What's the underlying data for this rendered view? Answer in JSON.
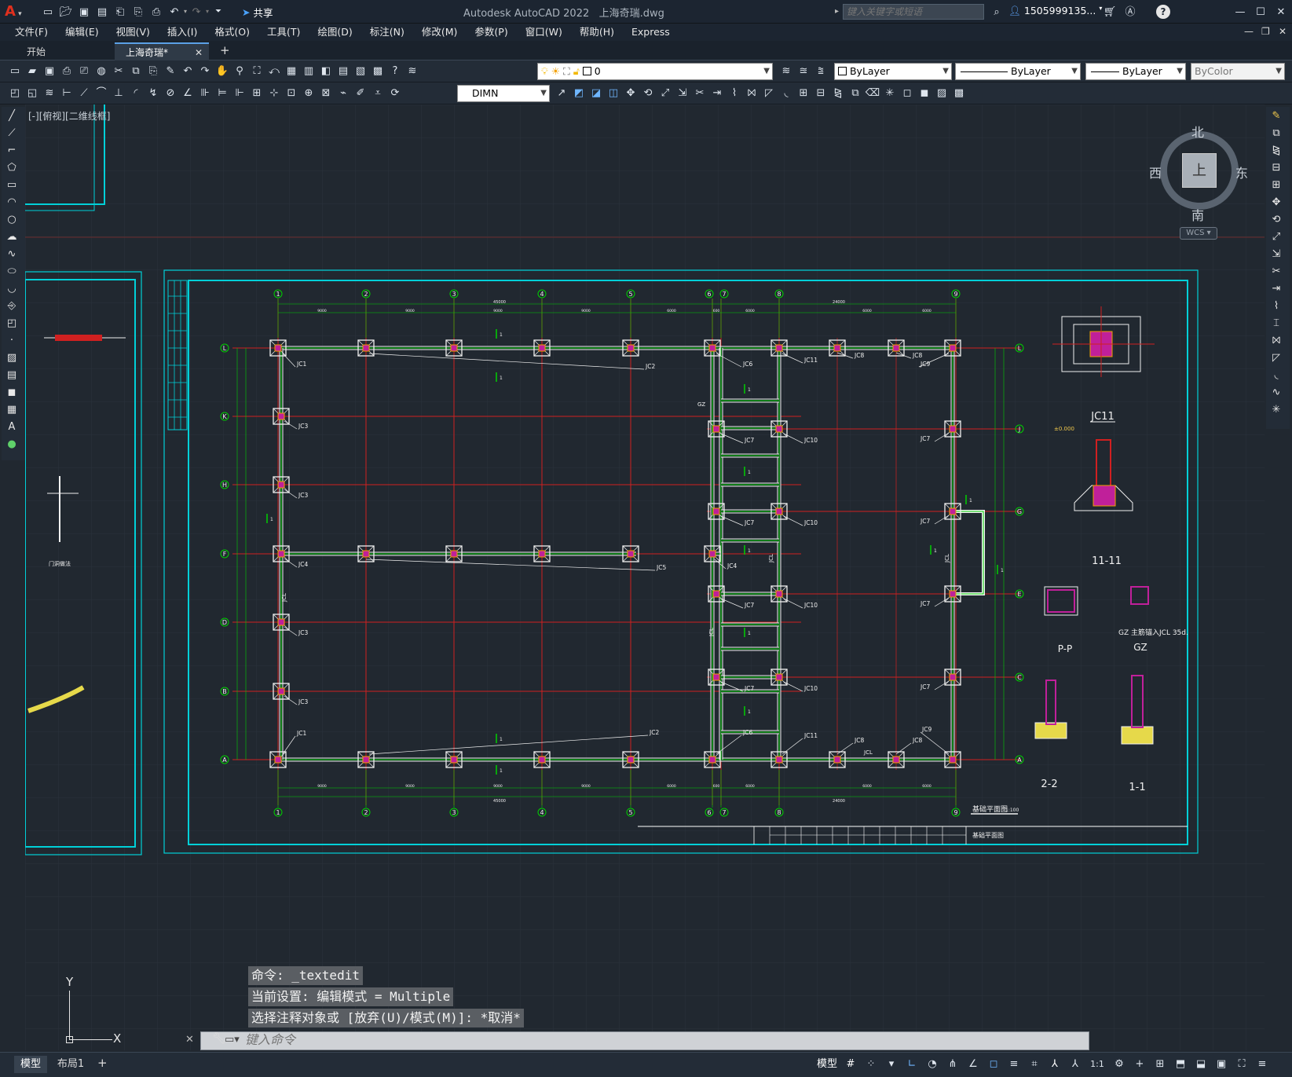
{
  "app": {
    "title": "Autodesk AutoCAD 2022",
    "file": "上海奇瑞.dwg",
    "share_label": "共享",
    "search_placeholder": "键入关键字或短语",
    "user": "1505999135...",
    "logo": "A"
  },
  "menu": [
    "文件(F)",
    "编辑(E)",
    "视图(V)",
    "插入(I)",
    "格式(O)",
    "工具(T)",
    "绘图(D)",
    "标注(N)",
    "修改(M)",
    "参数(P)",
    "窗口(W)",
    "帮助(H)",
    "Express"
  ],
  "tabs": {
    "start": "开始",
    "active": "上海奇瑞*",
    "add": "+"
  },
  "layer": {
    "current": "0",
    "color": "ByLayer",
    "linetype": "ByLayer",
    "lineweight": "ByLayer",
    "plotstyle": "ByColor"
  },
  "dimstyle": "DIMN",
  "viewport_label": "[-][俯视][二维线框]",
  "viewcube": {
    "north": "北",
    "south": "南",
    "east": "东",
    "west": "西",
    "top": "上",
    "wcs": "WCS"
  },
  "drawing": {
    "grid_x": [
      "1",
      "2",
      "3",
      "4",
      "5",
      "6",
      "7",
      "8",
      "9"
    ],
    "grid_y": [
      "L",
      "K",
      "H",
      "F",
      "D",
      "B",
      "A"
    ],
    "grid_y_right": [
      "L",
      "J",
      "G",
      "E",
      "C",
      "A"
    ],
    "footings_top": [
      "JC1",
      "JC2",
      "JC6",
      "JC11",
      "JC8",
      "JC8",
      "JC9"
    ],
    "footings_mid": [
      "JC3",
      "JC7",
      "JC10",
      "JC7",
      "JC3",
      "JC7",
      "JC10",
      "JC7",
      "JC4",
      "JC4",
      "JC5",
      "JC7",
      "JC10",
      "JC7",
      "JC3",
      "JC7",
      "JC10",
      "JC7",
      "JC3"
    ],
    "footings_bot": [
      "JC1",
      "JC2",
      "JC6",
      "JC11",
      "JC8",
      "JC8",
      "JC9"
    ],
    "beam_label": "JCL",
    "col_label": "GZ",
    "sections": [
      "JC11",
      "11-11",
      "P-P",
      "GZ",
      "2-2",
      "1-1"
    ],
    "gz_note": "GZ 主筋锚入JCL 35d.",
    "elev_label": "±0.000",
    "plan_title": "基础平面图",
    "plan_scale": "1:100",
    "dim_total_top": "45000",
    "dim_right_total": "24000",
    "dims_top": [
      "9000",
      "9000",
      "9000",
      "9000",
      "6000",
      "600",
      "6000",
      "6000",
      "6000"
    ],
    "left_labels": [
      "门洞做法"
    ]
  },
  "command": {
    "history": [
      "命令: _textedit",
      "当前设置: 编辑模式 = Multiple",
      "选择注释对象或 [放弃(U)/模式(M)]: *取消*"
    ],
    "placeholder": "键入命令"
  },
  "ucs": {
    "x": "X",
    "y": "Y"
  },
  "layouts": {
    "model": "模型",
    "layout1": "布局1",
    "add": "+"
  },
  "status": {
    "model": "模型",
    "scale": "1:1"
  }
}
